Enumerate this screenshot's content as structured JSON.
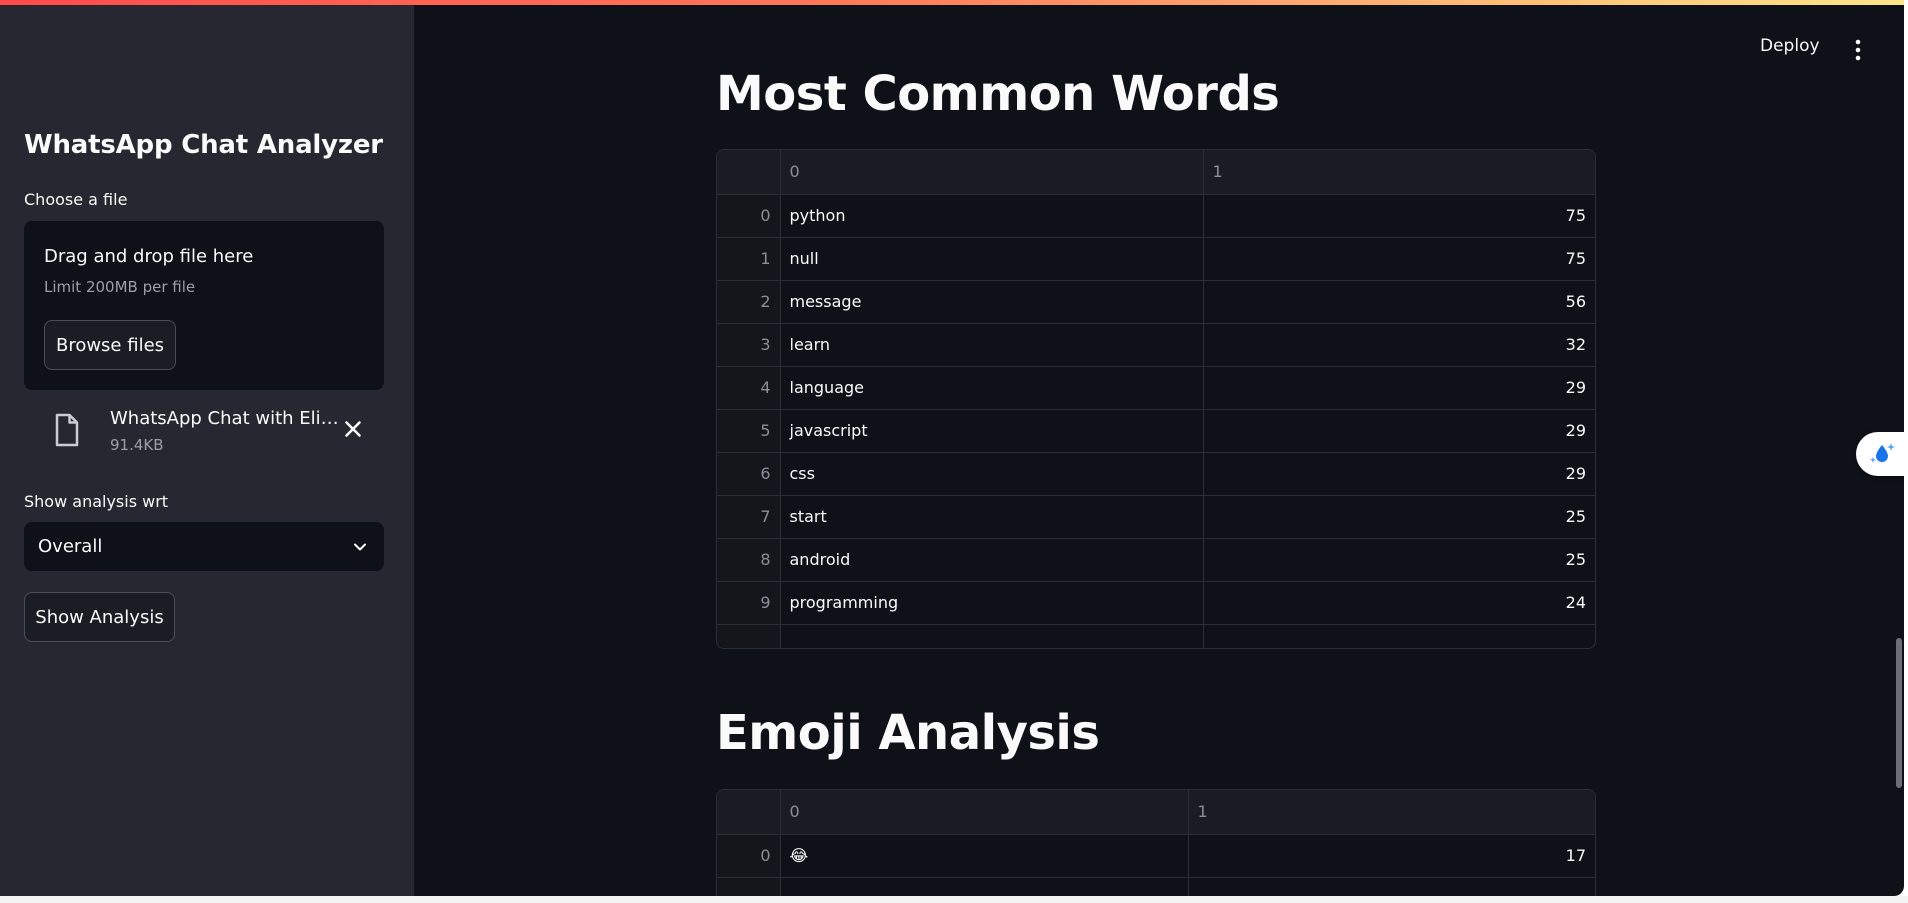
{
  "header": {
    "deploy_label": "Deploy"
  },
  "sidebar": {
    "title": "WhatsApp Chat Analyzer",
    "file_label": "Choose a file",
    "dropzone_title": "Drag and drop file here",
    "dropzone_limit": "Limit 200MB per file",
    "browse_label": "Browse files",
    "file_name": "WhatsApp Chat with Elite…",
    "file_size": "91.4KB",
    "select_label": "Show analysis wrt",
    "select_value": "Overall",
    "show_button": "Show Analysis"
  },
  "main": {
    "common_words_title": "Most Common Words",
    "common_words_headers": [
      "",
      "0",
      "1"
    ],
    "common_words_rows": [
      [
        "0",
        "python",
        "75"
      ],
      [
        "1",
        "null",
        "75"
      ],
      [
        "2",
        "message",
        "56"
      ],
      [
        "3",
        "learn",
        "32"
      ],
      [
        "4",
        "language",
        "29"
      ],
      [
        "5",
        "javascript",
        "29"
      ],
      [
        "6",
        "css",
        "29"
      ],
      [
        "7",
        "start",
        "25"
      ],
      [
        "8",
        "android",
        "25"
      ],
      [
        "9",
        "programming",
        "24"
      ]
    ],
    "emoji_title": "Emoji Analysis",
    "emoji_headers": [
      "",
      "0",
      "1"
    ],
    "emoji_rows": [
      [
        "0",
        "😂",
        "17"
      ]
    ]
  },
  "colors": {
    "accent": "#ff4b4b",
    "background": "#0e1117",
    "sidebar": "#262730"
  }
}
